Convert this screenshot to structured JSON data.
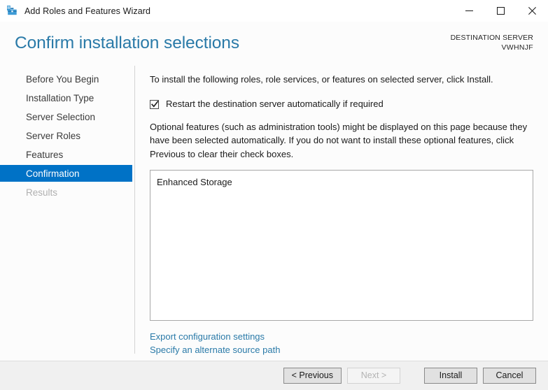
{
  "window": {
    "title": "Add Roles and Features Wizard",
    "icon": "toolbox-icon",
    "controls": {
      "minimize": "minimize-icon",
      "maximize": "maximize-icon",
      "close": "close-icon"
    }
  },
  "header": {
    "page_title": "Confirm installation selections",
    "destination_label": "DESTINATION SERVER",
    "destination_server": "VWHNJF",
    "title_color": "#2a7aa8"
  },
  "sidebar": {
    "items": [
      {
        "label": "Before You Begin",
        "state": "normal"
      },
      {
        "label": "Installation Type",
        "state": "normal"
      },
      {
        "label": "Server Selection",
        "state": "normal"
      },
      {
        "label": "Server Roles",
        "state": "normal"
      },
      {
        "label": "Features",
        "state": "normal"
      },
      {
        "label": "Confirmation",
        "state": "selected"
      },
      {
        "label": "Results",
        "state": "disabled"
      }
    ],
    "selected_color": "#0072c6"
  },
  "content": {
    "intro": "To install the following roles, role services, or features on selected server, click Install.",
    "restart_checkbox": {
      "label": "Restart the destination server automatically if required",
      "checked": true
    },
    "note": "Optional features (such as administration tools) might be displayed on this page because they have been selected automatically. If you do not want to install these optional features, click Previous to clear their check boxes.",
    "selection_list": [
      "Enhanced Storage"
    ],
    "links": [
      "Export configuration settings",
      "Specify an alternate source path"
    ],
    "link_color": "#2a7aa8"
  },
  "footer": {
    "buttons": [
      {
        "label": "< Previous",
        "enabled": true
      },
      {
        "label": "Next >",
        "enabled": false
      },
      {
        "label": "Install",
        "enabled": true
      },
      {
        "label": "Cancel",
        "enabled": true
      }
    ]
  }
}
